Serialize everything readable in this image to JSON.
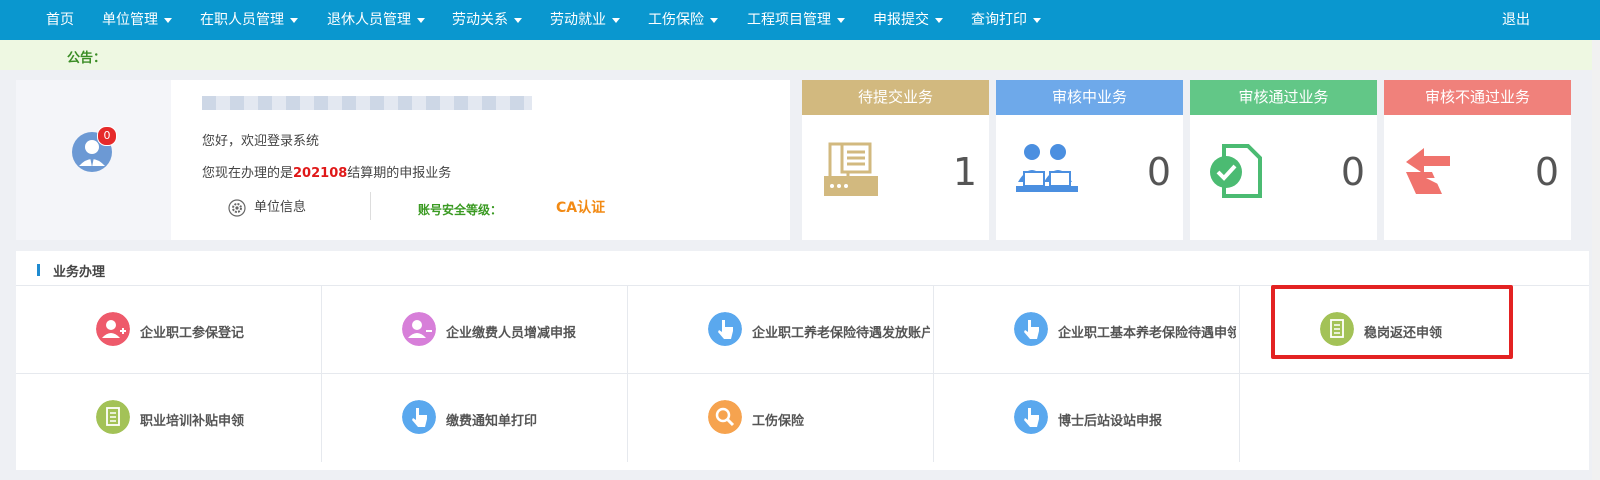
{
  "nav": {
    "items": [
      {
        "label": "首页",
        "dropdown": false
      },
      {
        "label": "单位管理",
        "dropdown": true
      },
      {
        "label": "在职人员管理",
        "dropdown": true
      },
      {
        "label": "退休人员管理",
        "dropdown": true
      },
      {
        "label": "劳动关系",
        "dropdown": true
      },
      {
        "label": "劳动就业",
        "dropdown": true
      },
      {
        "label": "工伤保险",
        "dropdown": true
      },
      {
        "label": "工程项目管理",
        "dropdown": true
      },
      {
        "label": "申报提交",
        "dropdown": true
      },
      {
        "label": "查询打印",
        "dropdown": true
      }
    ],
    "logout": "退出"
  },
  "notice": {
    "label": "公告："
  },
  "user": {
    "badge": "0",
    "greeting": "您好，欢迎登录系统",
    "period_prefix": "您现在办理的是",
    "period_value": "202108",
    "period_suffix": "结算期的申报业务",
    "unit_info": "单位信息",
    "security_label": "账号安全等级：",
    "security_value": "CA认证"
  },
  "stats": [
    {
      "title": "待提交业务",
      "count": "1",
      "color": "#d2b97f",
      "icon": "fax-icon"
    },
    {
      "title": "审核中业务",
      "count": "0",
      "color": "#6ea9ea",
      "icon": "reviewers-icon"
    },
    {
      "title": "审核通过业务",
      "count": "0",
      "color": "#62c787",
      "icon": "approved-doc-icon"
    },
    {
      "title": "审核不通过业务",
      "count": "0",
      "color": "#f0817b",
      "icon": "rejected-arrows-icon"
    }
  ],
  "business": {
    "title": "业务办理",
    "tiles": [
      {
        "label": "企业职工参保登记",
        "color": "#ee5a6b",
        "icon": "user-add-icon"
      },
      {
        "label": "企业缴费人员增减申报",
        "color": "#d77fd9",
        "icon": "user-remove-icon"
      },
      {
        "label": "企业职工养老保险待遇发放账户",
        "color": "#5aa8ee",
        "icon": "pointer-hand-icon"
      },
      {
        "label": "企业职工基本养老保险待遇申领",
        "color": "#5aa8ee",
        "icon": "pointer-hand-icon"
      },
      {
        "label": "稳岗返还申领",
        "color": "#a3c257",
        "icon": "document-icon"
      },
      {
        "label": "职业培训补贴申领",
        "color": "#a3c257",
        "icon": "document-icon"
      },
      {
        "label": "缴费通知单打印",
        "color": "#5aa8ee",
        "icon": "pointer-hand-icon"
      },
      {
        "label": "工伤保险",
        "color": "#f6a34f",
        "icon": "search-icon"
      },
      {
        "label": "博士后站设站申报",
        "color": "#5aa8ee",
        "icon": "pointer-hand-icon"
      }
    ]
  }
}
